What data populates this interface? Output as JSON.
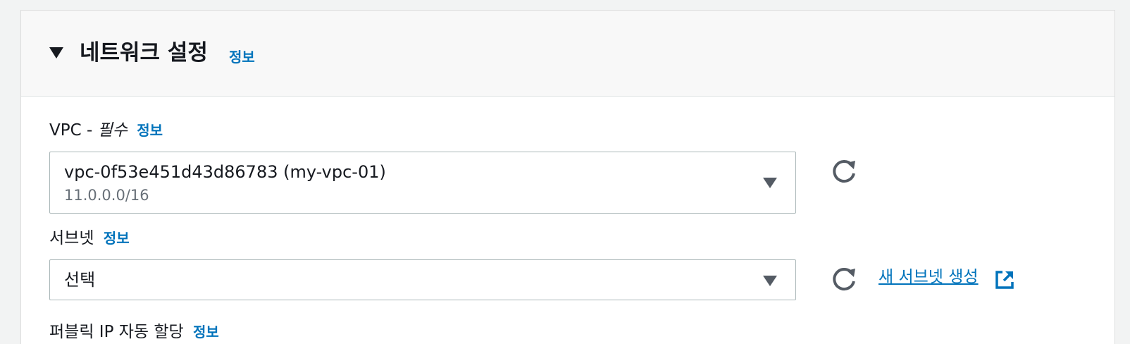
{
  "section": {
    "title": "네트워크 설정",
    "info": "정보"
  },
  "vpc": {
    "label": "VPC -",
    "required": "필수",
    "info": "정보",
    "selected_value": "vpc-0f53e451d43d86783 (my-vpc-01)",
    "selected_sub": "11.0.0.0/16"
  },
  "subnet": {
    "label": "서브넷",
    "info": "정보",
    "selected_value": "선택",
    "create_link": "새 서브넷 생성"
  },
  "public_ip": {
    "label": "퍼블릭 IP 자동 할당",
    "info": "정보"
  },
  "icons": {
    "collapse": "caret-down-icon",
    "refresh": "refresh-icon",
    "dropdown": "caret-down-icon",
    "external": "external-link-icon"
  },
  "colors": {
    "link": "#0073bb",
    "text": "#16191f",
    "secondary_text": "#687078",
    "border": "#aab7b8",
    "header_bg": "#f8f8f8",
    "page_bg": "#f2f3f3"
  }
}
